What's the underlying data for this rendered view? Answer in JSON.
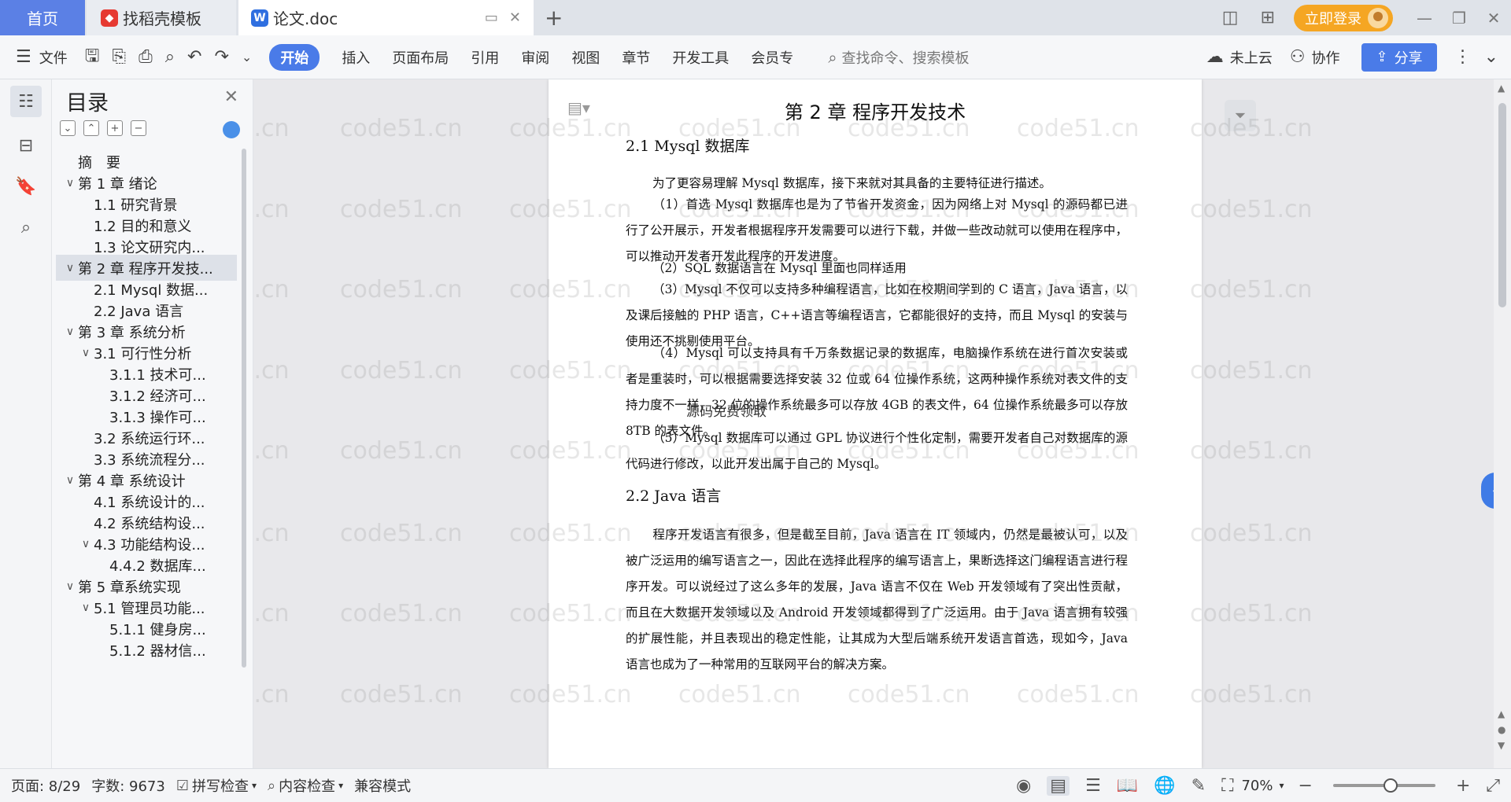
{
  "tabs": {
    "home": "首页",
    "template": "找稻壳模板",
    "doc": "论文.doc",
    "new_tab": "+"
  },
  "account": {
    "login": "立即登录"
  },
  "ribbon": {
    "file": "文件",
    "items": [
      "开始",
      "插入",
      "页面布局",
      "引用",
      "审阅",
      "视图",
      "章节",
      "开发工具",
      "会员专"
    ],
    "search_placeholder": "查找命令、搜索模板",
    "cloud": "未上云",
    "collab": "协作",
    "share": "分享"
  },
  "toc": {
    "title": "目录",
    "items": [
      {
        "label": "摘　要",
        "level": 1,
        "chevron": ""
      },
      {
        "label": "第 1 章  绪论",
        "level": 1,
        "chevron": "∨"
      },
      {
        "label": "1.1  研究背景",
        "level": 2,
        "chevron": ""
      },
      {
        "label": "1.2 目的和意义",
        "level": 2,
        "chevron": ""
      },
      {
        "label": "1.3  论文研究内...",
        "level": 2,
        "chevron": ""
      },
      {
        "label": "第 2 章  程序开发技...",
        "level": 1,
        "chevron": "∨",
        "selected": true
      },
      {
        "label": "2.1 Mysql 数据...",
        "level": 2,
        "chevron": ""
      },
      {
        "label": "2.2 Java 语言",
        "level": 2,
        "chevron": ""
      },
      {
        "label": "第 3 章  系统分析",
        "level": 1,
        "chevron": "∨"
      },
      {
        "label": "3.1 可行性分析",
        "level": 2,
        "chevron": "∨"
      },
      {
        "label": "3.1.1 技术可...",
        "level": 3,
        "chevron": ""
      },
      {
        "label": "3.1.2 经济可...",
        "level": 3,
        "chevron": ""
      },
      {
        "label": "3.1.3 操作可...",
        "level": 3,
        "chevron": ""
      },
      {
        "label": "3.2 系统运行环...",
        "level": 2,
        "chevron": ""
      },
      {
        "label": "3.3 系统流程分...",
        "level": 2,
        "chevron": ""
      },
      {
        "label": "第 4 章  系统设计",
        "level": 1,
        "chevron": "∨"
      },
      {
        "label": "4.1  系统设计的...",
        "level": 2,
        "chevron": ""
      },
      {
        "label": "4.2  系统结构设...",
        "level": 2,
        "chevron": ""
      },
      {
        "label": "4.3 功能结构设...",
        "level": 2,
        "chevron": "∨"
      },
      {
        "label": "4.4.2  数据库...",
        "level": 3,
        "chevron": ""
      },
      {
        "label": "第 5 章系统实现",
        "level": 1,
        "chevron": "∨"
      },
      {
        "label": "5.1 管理员功能...",
        "level": 2,
        "chevron": "∨"
      },
      {
        "label": "5.1.1  健身房...",
        "level": 3,
        "chevron": ""
      },
      {
        "label": "5.1.2  器材信...",
        "level": 3,
        "chevron": ""
      }
    ]
  },
  "document": {
    "title": "第 2 章  程序开发技术",
    "sec1": "2.1 Mysql 数据库",
    "p1": "为了更容易理解 Mysql 数据库，接下来就对其具备的主要特征进行描述。",
    "p2": "（1）首选 Mysql 数据库也是为了节省开发资金，因为网络上对 Mysql 的源码都已进行了公开展示，开发者根据程序开发需要可以进行下载，并做一些改动就可以使用在程序中，可以推动开发者开发此程序的开发进度。",
    "p3": "（2）SQL 数据语言在 Mysql 里面也同样适用",
    "p4": "（3）Mysql 不仅可以支持多种编程语言，比如在校期间学到的 C 语言，Java 语言，以及课后接触的 PHP 语言，C++语言等编程语言，它都能很好的支持，而且 Mysql 的安装与使用还不挑剔使用平台。",
    "p5": "（4）Mysql 可以支持具有千万条数据记录的数据库，电脑操作系统在进行首次安装或者是重装时，可以根据需要选择安装 32 位或 64 位操作系统，这两种操作系统对表文件的支持力度不一样，32 位的操作系统最多可以存放 4GB 的表文件，64 位操作系统最多可以存放 8TB 的表文件。",
    "p6": "（5）Mysql 数据库可以通过 GPL 协议进行个性化定制，需要开发者自己对数据库的源代码进行修改，以此开发出属于自己的 Mysql。",
    "sec2": "2.2 Java 语言",
    "p7": "程序开发语言有很多，但是截至目前，Java 语言在 IT 领域内，仍然是最被认可，以及被广泛运用的编写语言之一，因此在选择此程序的编写语言上，果断选择这门编程语言进行程序开发。可以说经过了这么多年的发展，Java 语言不仅在 Web 开发领域有了突出性贡献，而且在大数据开发领域以及 Android 开发领域都得到了广泛运用。由于 Java 语言拥有较强的扩展性能，并且表现出的稳定性能，让其成为大型后端系统开发语言首选，现如今，Java 语言也成为了一种常用的互联网平台的解决方案。",
    "float_note": "源码免费领取"
  },
  "watermark": "code51.cn",
  "status": {
    "page": "页面: 8/29",
    "words": "字数: 9673",
    "spell": "拼写检查",
    "content": "内容检查",
    "compat": "兼容模式",
    "zoom": "70%"
  },
  "colors": {
    "accent": "#4a7be8",
    "login": "#f5a623",
    "home_tab": "#5b80e5"
  }
}
